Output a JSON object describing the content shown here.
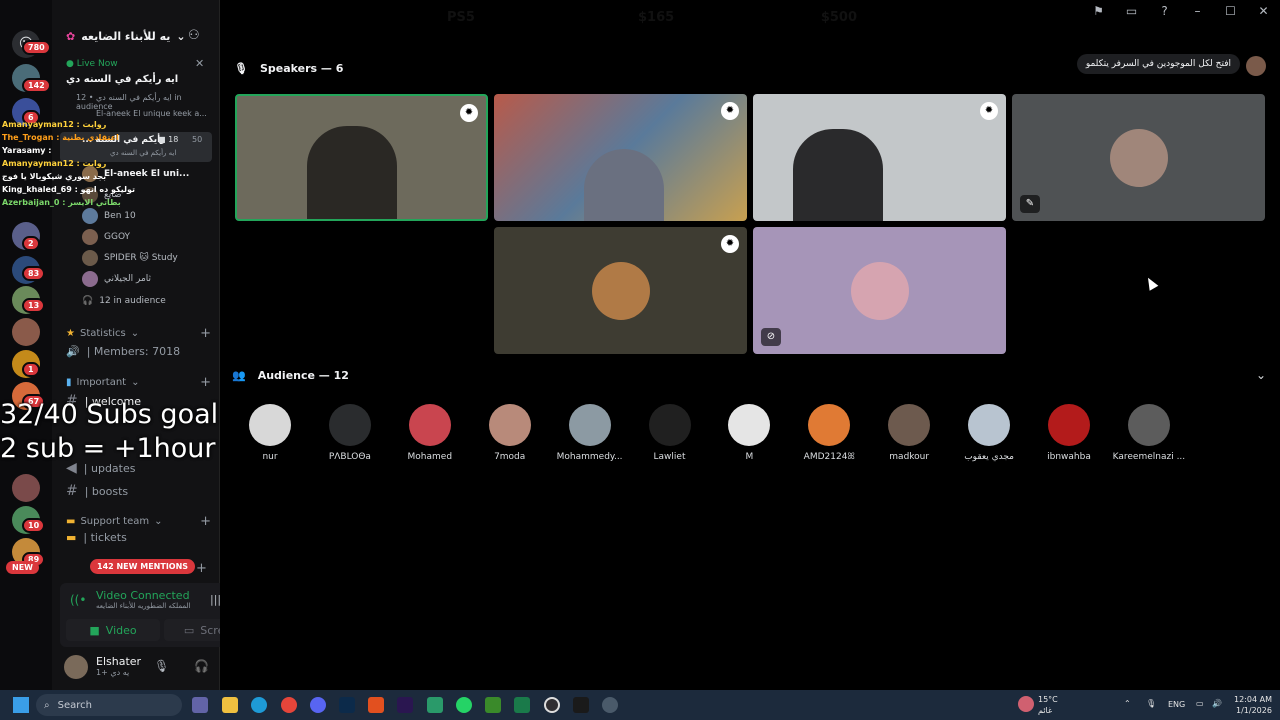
{
  "goal": {
    "left_label": "PS5",
    "current": "$165",
    "target": "$500",
    "progress": 0.33
  },
  "window_controls": [
    "⚑",
    "▭",
    "?",
    "–",
    "☐",
    "✕"
  ],
  "server_rail": {
    "badges": [
      "780",
      "142",
      "6",
      "2",
      "83",
      "13",
      "1",
      "10",
      "67",
      "89"
    ],
    "new_label": "NEW"
  },
  "sidebar": {
    "server_name": "يه للأبناء الضايعه",
    "live_label": "Live Now",
    "stage_title": "ايه رأيكم في السنه دي",
    "stage_meta": "ايه رأيكم في السنه دي • 12 in audience",
    "stage_meta2": "El-aneek El unique keek a...",
    "voice_channel": {
      "label": "... رأيكم في السنه",
      "count_a": "18",
      "count_b": "50",
      "sub": "ايه رأيكم في السنه دي"
    },
    "voice_users": [
      {
        "name": "El-aneek El uni...",
        "color": "#8a6b4a"
      },
      {
        "name": "ضايع",
        "color": "#5a4a3a"
      },
      {
        "name": "Ben 10",
        "color": "#5d7a9c"
      },
      {
        "name": "GGOY",
        "color": "#7b5f4f"
      },
      {
        "name": "SPIDER 🐱 Study",
        "color": "#6b5a4a"
      },
      {
        "name": "ثامر الجيلاني",
        "color": "#8b6b8e"
      }
    ],
    "audience_row": "12 in audience",
    "statistics_label": "Statistics",
    "members_label": "| Members: 7018",
    "important_label": "Important",
    "channels": [
      {
        "name": "| welcome"
      },
      {
        "name": "| updates"
      },
      {
        "name": "| boosts"
      }
    ],
    "support_label": "Support team",
    "tickets_label": "| tickets",
    "mentions_label": "142 NEW MENTIONS",
    "vc_title": "Video Connected",
    "vc_sub": "المملكه الضطوريه للأبناء الضايعه",
    "video_label": "Video",
    "screen_label": "Screen",
    "user_name": "Elshater",
    "user_status": "يه دي +1"
  },
  "overlay": {
    "subs_line1": "32/40 Subs goal",
    "subs_line2": "2 sub = +1hour",
    "chat": [
      {
        "text": "Amanyayman12 : روايت",
        "color": "#ffd23b"
      },
      {
        "text": "The_Trogan : اعتقادي بطنية",
        "color": "#ff9f1a"
      },
      {
        "text": "Yarasamy :",
        "color": "#ffffff"
      },
      {
        "text": "Amanyayman12 : روايت",
        "color": "#ffd23b"
      },
      {
        "text": "بجد سوري شيكوبالا يا فوج",
        "color": "#ffffff"
      },
      {
        "text": "King_khaled_69 : توليكو ده انهو",
        "color": "#ffffff"
      },
      {
        "text": "Azerbaijan_0 : بطاتي الايسر",
        "color": "#7bd86a"
      }
    ]
  },
  "stage": {
    "speakers_label": "Speakers — 6",
    "audience_label": "Audience — 12",
    "topic_pill": "افتح لكل الموجودين في السرفر يتكلمو",
    "speakers": [
      {
        "bg": "#6d6a5c"
      },
      {
        "bg": "#6a6c6e"
      },
      {
        "bg": "#c3c7c9"
      },
      {
        "bg": "#4f5254",
        "avatar": "#a0867a"
      },
      {
        "bg": "#3e3c32",
        "avatar": "#b07a46"
      },
      {
        "bg": "#a695b8",
        "avatar": "#d6a4b0"
      }
    ],
    "audience": [
      {
        "name": "nur",
        "color": "#d8d8d8"
      },
      {
        "name": "PΛBLOΘa",
        "color": "#2a2c2e"
      },
      {
        "name": "Mohamed",
        "color": "#c9454f"
      },
      {
        "name": "7moda",
        "color": "#b88a7a"
      },
      {
        "name": "Mohammedy...",
        "color": "#8c9aa3"
      },
      {
        "name": "Lawliet",
        "color": "#202020"
      },
      {
        "name": "M",
        "color": "#e5e5e5"
      },
      {
        "name": "AMD2124ꕤ",
        "color": "#e07a34"
      },
      {
        "name": "madkour",
        "color": "#6d5a4e"
      },
      {
        "name": "مجدي يعقوب",
        "color": "#b8c4d0"
      },
      {
        "name": "ibnwahba",
        "color": "#b31b1b"
      },
      {
        "name": "Kareemelnazi ...",
        "color": "#5c5c5c"
      }
    ]
  },
  "taskbar": {
    "search_placeholder": "Search",
    "weather_temp": "15°C",
    "weather_desc": "غائم",
    "lang": "ENG",
    "time": "12:04 AM",
    "date": "1/1/2026"
  }
}
